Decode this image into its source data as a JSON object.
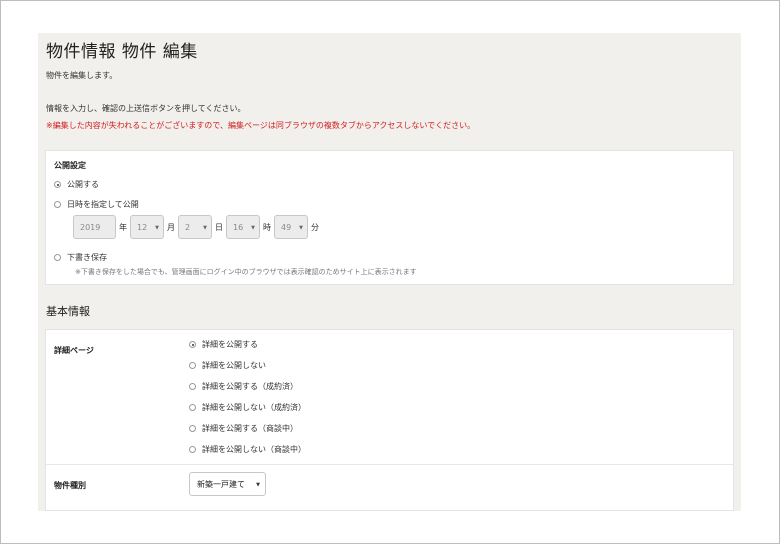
{
  "header": {
    "title": "物件情報 物件 編集",
    "subtitle": "物件を編集します。",
    "instruction": "情報を入力し、確認の上送信ボタンを押してください。",
    "warning": "※編集した内容が失われることがございますので、編集ページは同ブラウザの複数タブからアクセスしないでください。"
  },
  "publish": {
    "title": "公開設定",
    "options": [
      "公開する",
      "日時を指定して公開",
      "下書き保存"
    ],
    "selected": "公開する",
    "datetime": {
      "year": "2019",
      "year_unit": "年",
      "month": "12",
      "month_unit": "月",
      "day": "2",
      "day_unit": "日",
      "hour": "16",
      "hour_unit": "時",
      "minute": "49",
      "minute_unit": "分"
    },
    "draft_note": "※下書き保存をした場合でも、管理画面にログイン中のブラウザでは表示確認のためサイト上に表示されます"
  },
  "basic": {
    "title": "基本情報",
    "detail_label": "詳細ページ",
    "detail_options": [
      "詳細を公開する",
      "詳細を公開しない",
      "詳細を公開する（成約済）",
      "詳細を公開しない（成約済）",
      "詳細を公開する（商談中）",
      "詳細を公開しない（商談中）"
    ],
    "detail_selected": "詳細を公開する",
    "type_label": "物件種別",
    "type_value": "新築一戸建て"
  },
  "colors": {
    "warning": "#d21f1f",
    "panel_bg": "#f1f0ec"
  }
}
